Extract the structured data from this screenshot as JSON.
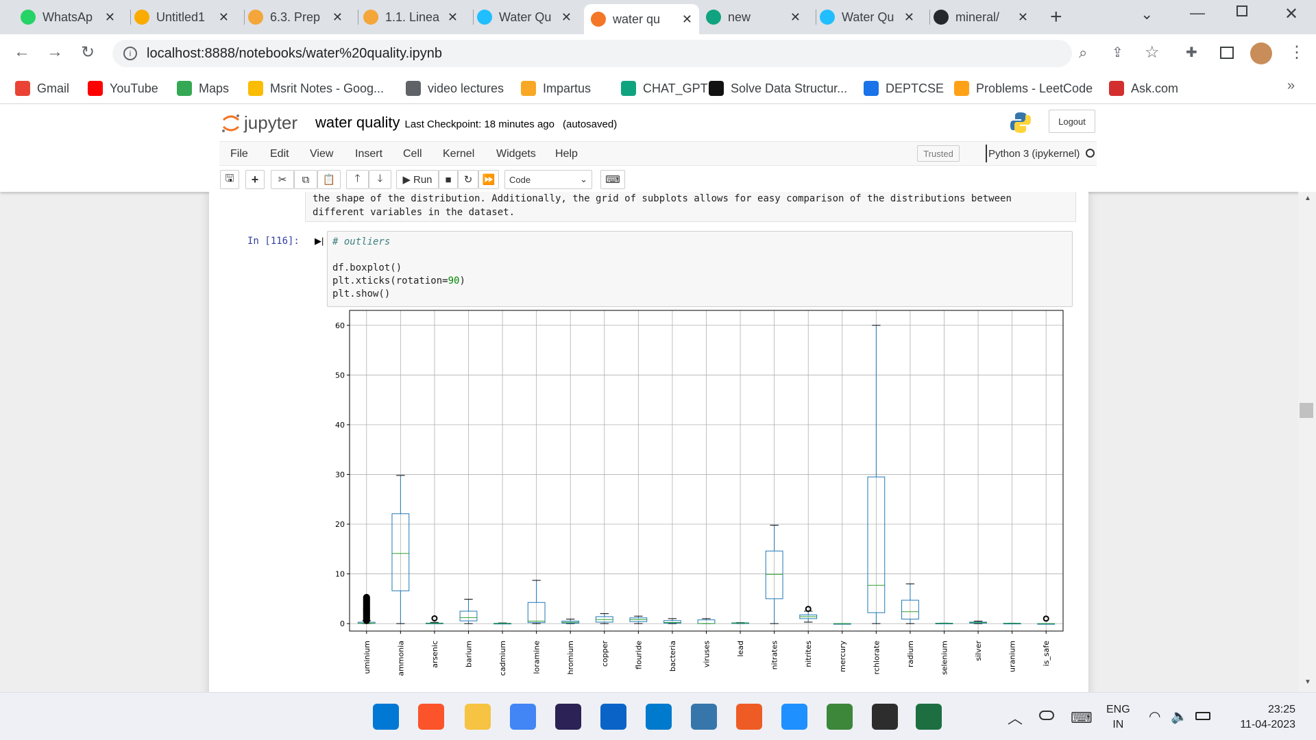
{
  "browser": {
    "tabs": [
      {
        "title": "WhatsAp",
        "icon": "whatsapp-icon",
        "color": "#25d366"
      },
      {
        "title": "Untitled1",
        "icon": "colab-icon",
        "color": "#f9ab00"
      },
      {
        "title": "6.3. Prep",
        "icon": "chart-bars-icon",
        "color": "#f4a63a"
      },
      {
        "title": "1.1. Linea",
        "icon": "chart-bars-icon",
        "color": "#f4a63a"
      },
      {
        "title": "Water Qu",
        "icon": "kaggle-icon",
        "color": "#20beff"
      },
      {
        "title": "water qu",
        "icon": "jupyter-book-icon",
        "color": "#f37726"
      },
      {
        "title": "new",
        "icon": "chatgpt-icon",
        "color": "#10a37f"
      },
      {
        "title": "Water Qu",
        "icon": "kaggle-icon",
        "color": "#20beff"
      },
      {
        "title": "mineral/",
        "icon": "github-icon",
        "color": "#24292e"
      }
    ],
    "url": "localhost:8888/notebooks/water%20quality.ipynb",
    "bookmarks": [
      {
        "label": "Gmail",
        "icon": "gmail-icon",
        "color": "#ea4335"
      },
      {
        "label": "YouTube",
        "icon": "youtube-icon",
        "color": "#ff0000"
      },
      {
        "label": "Maps",
        "icon": "maps-icon",
        "color": "#34a853"
      },
      {
        "label": "Msrit Notes - Goog...",
        "icon": "drive-icon",
        "color": "#fbbc04"
      },
      {
        "label": "video lectures",
        "icon": "globe-icon",
        "color": "#5f6368"
      },
      {
        "label": "Impartus",
        "icon": "impartus-icon",
        "color": "#f9a825"
      },
      {
        "label": "CHAT_GPT",
        "icon": "chatgpt-icon",
        "color": "#10a37f"
      },
      {
        "label": "Solve Data Structur...",
        "icon": "hackerrank-icon",
        "color": "#111111"
      },
      {
        "label": "DEPTCSE",
        "icon": "window-icon",
        "color": "#1a73e8"
      },
      {
        "label": "Problems - LeetCode",
        "icon": "leetcode-icon",
        "color": "#ffa116"
      },
      {
        "label": "Ask.com",
        "icon": "ask-icon",
        "color": "#d32f2f"
      }
    ],
    "bookmarks_more": "»"
  },
  "jupyter": {
    "logo": "jupyter",
    "notebook_name": "water quality",
    "checkpoint": "Last Checkpoint: 18 minutes ago",
    "autosave": "(autosaved)",
    "logout": "Logout",
    "menus": [
      "File",
      "Edit",
      "View",
      "Insert",
      "Cell",
      "Kernel",
      "Widgets",
      "Help"
    ],
    "trusted": "Trusted",
    "kernel": "Python 3 (ipykernel)",
    "run_label": "Run",
    "cell_type": "Code"
  },
  "notebook": {
    "markdown_line1": "the shape of the distribution. Additionally, the grid of subplots allows for easy comparison of the distributions between",
    "markdown_line2": "different variables in the dataset.",
    "prompt": "In [116]:",
    "code_comment": "# outliers",
    "code_line1": "df.boxplot()",
    "code_line2_a": "plt.xticks(rotation=",
    "code_line2_num": "90",
    "code_line2_b": ")",
    "code_line3": "plt.show()"
  },
  "chart_data": {
    "type": "box",
    "title": "",
    "xlabel": "",
    "ylabel": "",
    "ylim": [
      -1.5,
      63
    ],
    "yticks": [
      0,
      10,
      20,
      30,
      40,
      50,
      60
    ],
    "grid": true,
    "categories": [
      "uminium",
      "ammonia",
      "arsenic",
      "barium",
      "cadmium",
      "loramine",
      "hromium",
      "copper",
      "flouride",
      "bacteria",
      "viruses",
      "lead",
      "nitrates",
      "nitrites",
      "mercury",
      "rchlorate",
      "radium",
      "selenium",
      "silver",
      "uranium",
      "is_safe"
    ],
    "boxes": [
      {
        "min": 0.0,
        "q1": 0.05,
        "median": 0.07,
        "q3": 0.28,
        "max": 0.6,
        "outliers_max": 5.3
      },
      {
        "min": 0.0,
        "q1": 6.6,
        "median": 14.1,
        "q3": 22.1,
        "max": 29.8
      },
      {
        "min": 0.0,
        "q1": 0.03,
        "median": 0.05,
        "q3": 0.1,
        "max": 0.25,
        "outliers_max": 1.05
      },
      {
        "min": 0.0,
        "q1": 0.55,
        "median": 1.2,
        "q3": 2.5,
        "max": 4.9
      },
      {
        "min": 0.0,
        "q1": 0.01,
        "median": 0.04,
        "q3": 0.06,
        "max": 0.13
      },
      {
        "min": 0.0,
        "q1": 0.2,
        "median": 0.5,
        "q3": 4.25,
        "max": 8.7
      },
      {
        "min": 0.0,
        "q1": 0.1,
        "median": 0.25,
        "q3": 0.5,
        "max": 0.9
      },
      {
        "min": 0.0,
        "q1": 0.3,
        "median": 0.8,
        "q3": 1.4,
        "max": 2.0
      },
      {
        "min": 0.0,
        "q1": 0.4,
        "median": 0.8,
        "q3": 1.15,
        "max": 1.5
      },
      {
        "min": 0.0,
        "q1": 0.1,
        "median": 0.22,
        "q3": 0.6,
        "max": 1.0
      },
      {
        "min": 0.0,
        "q1": 0.0,
        "median": 0.008,
        "q3": 0.75,
        "max": 1.0
      },
      {
        "min": 0.0,
        "q1": 0.03,
        "median": 0.1,
        "q3": 0.15,
        "max": 0.2
      },
      {
        "min": 0.0,
        "q1": 5.0,
        "median": 9.9,
        "q3": 14.6,
        "max": 19.8
      },
      {
        "min": 0.3,
        "q1": 1.0,
        "median": 1.4,
        "q3": 1.75,
        "max": 2.5,
        "outliers_max": 2.95
      },
      {
        "min": 0.0,
        "q1": 0.002,
        "median": 0.005,
        "q3": 0.007,
        "max": 0.01
      },
      {
        "min": 0.0,
        "q1": 2.2,
        "median": 7.7,
        "q3": 29.5,
        "max": 60.0
      },
      {
        "min": 0.0,
        "q1": 0.9,
        "median": 2.4,
        "q3": 4.7,
        "max": 8.0
      },
      {
        "min": 0.0,
        "q1": 0.03,
        "median": 0.05,
        "q3": 0.08,
        "max": 0.1
      },
      {
        "min": 0.0,
        "q1": 0.1,
        "median": 0.2,
        "q3": 0.3,
        "max": 0.5
      },
      {
        "min": 0.0,
        "q1": 0.02,
        "median": 0.05,
        "q3": 0.07,
        "max": 0.09
      },
      {
        "min": 0.0,
        "q1": 0.0,
        "median": 0.0,
        "q3": 0.0,
        "max": 0.0,
        "outliers_max": 1.0
      }
    ],
    "colors": {
      "box": "#1f77b4",
      "median": "#2ca02c",
      "outlier": "#000000",
      "grid": "#b0b0b0"
    }
  },
  "taskbar": {
    "apps": [
      {
        "name": "windows-start-icon",
        "color": "#0078d4"
      },
      {
        "name": "brave-icon",
        "color": "#fb542b"
      },
      {
        "name": "file-explorer-icon",
        "color": "#f6c343"
      },
      {
        "name": "chrome-icon",
        "color": "#4285f4"
      },
      {
        "name": "eclipse-icon",
        "color": "#2c2255"
      },
      {
        "name": "monitor-icon",
        "color": "#0a64c8"
      },
      {
        "name": "vscode-icon",
        "color": "#007acc"
      },
      {
        "name": "python-idle-icon",
        "color": "#3776ab"
      },
      {
        "name": "postman-icon",
        "color": "#ef5b25"
      },
      {
        "name": "cortana-icon",
        "color": "#1e90ff"
      },
      {
        "name": "nodejs-icon",
        "color": "#3c873a"
      },
      {
        "name": "terminal-icon",
        "color": "#2d2d2d"
      },
      {
        "name": "excel-icon",
        "color": "#1d6f42"
      }
    ],
    "lang": "ENG",
    "region": "IN",
    "time": "23:25",
    "date": "11-04-2023"
  }
}
